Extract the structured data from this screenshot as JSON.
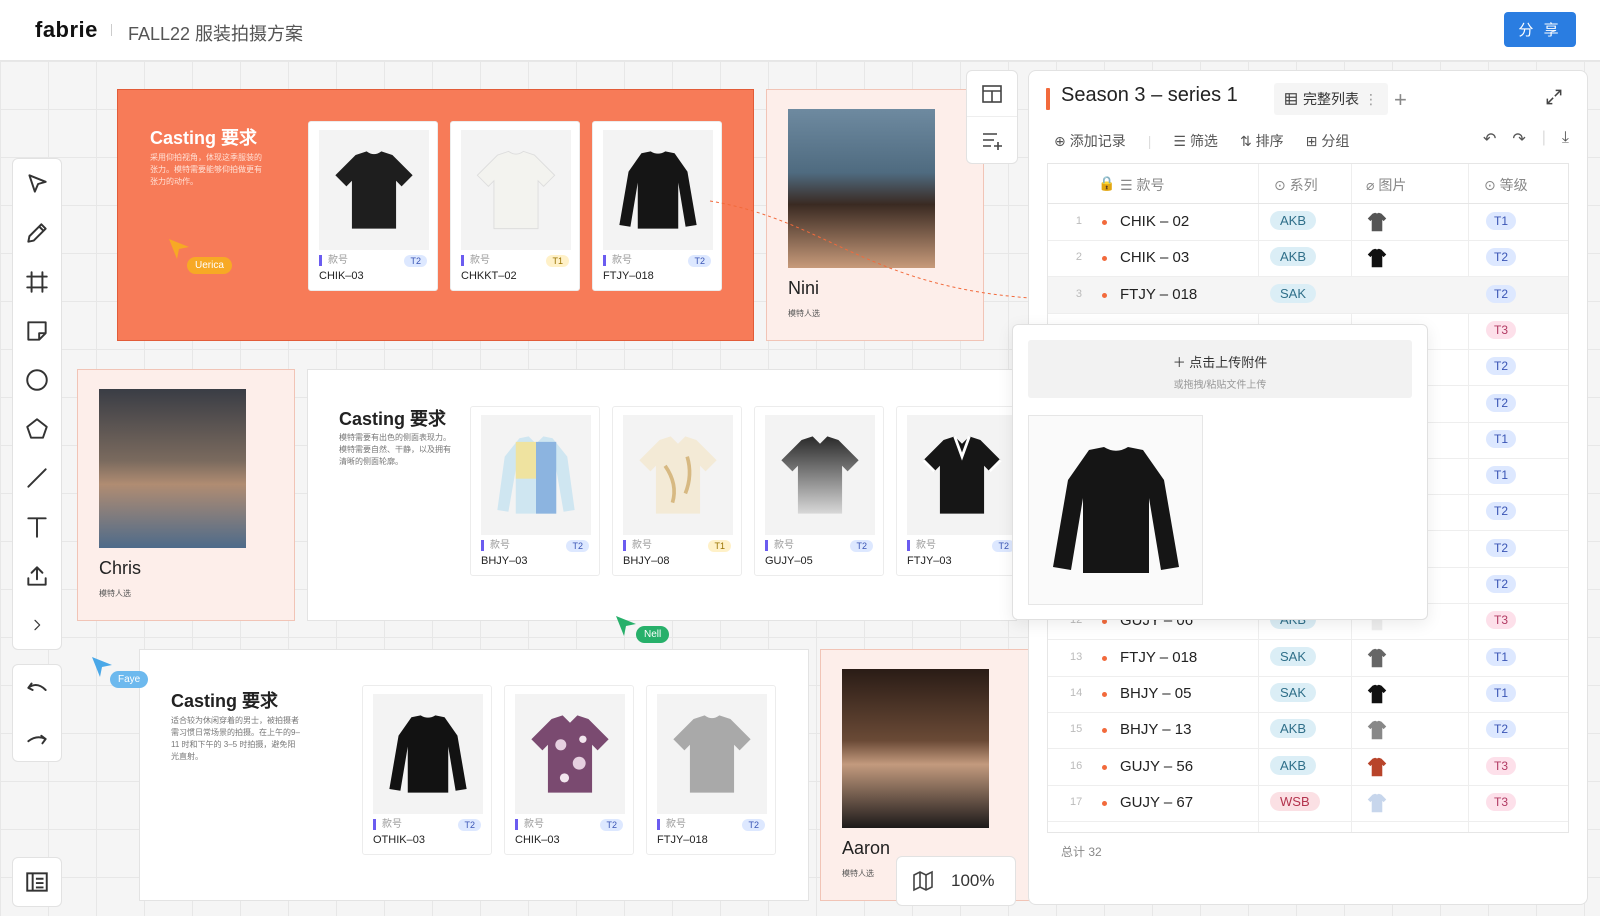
{
  "app": {
    "logo": "fabrie",
    "doc_title": "FALL22 服装拍摄方案",
    "share_label": "分 享"
  },
  "boards": [
    {
      "title": "Casting 要求",
      "desc": "采用仰拍视角，体现这季服装的张力。模特需要能够仰拍做更有张力的动作。",
      "cards": [
        {
          "label": "款号",
          "code": "CHIK–03",
          "grade": "T2"
        },
        {
          "label": "款号",
          "code": "CHKKT–02",
          "grade": "T1"
        },
        {
          "label": "款号",
          "code": "FTJY–018",
          "grade": "T2"
        }
      ]
    },
    {
      "title": "Casting 要求",
      "desc": "模特需要有出色的侧面表现力。模特需要自然、干静，以及拥有清晰的侧面轮廓。",
      "cards": [
        {
          "label": "款号",
          "code": "BHJY–03",
          "grade": "T2"
        },
        {
          "label": "款号",
          "code": "BHJY–08",
          "grade": "T1"
        },
        {
          "label": "款号",
          "code": "GUJY–05",
          "grade": "T2"
        },
        {
          "label": "款号",
          "code": "FTJY–03",
          "grade": "T2"
        }
      ]
    },
    {
      "title": "Casting 要求",
      "desc": "适合较为休闲穿着的男士，被拍摄者需习惯日常场景的拍摄。在上午的9–11 时和下午的 3–5 时拍摄，避免阳光直射。",
      "cards": [
        {
          "label": "款号",
          "code": "OTHIK–03",
          "grade": "T2"
        },
        {
          "label": "款号",
          "code": "CHIK–03",
          "grade": "T2"
        },
        {
          "label": "款号",
          "code": "FTJY–018",
          "grade": "T2"
        }
      ]
    }
  ],
  "models": [
    {
      "name": "Nini",
      "sub": "模特人选"
    },
    {
      "name": "Chris",
      "sub": "模特人选"
    },
    {
      "name": "Aaron",
      "sub": "模特人选"
    }
  ],
  "cursors": [
    {
      "name": "Uerica"
    },
    {
      "name": "Nell"
    },
    {
      "name": "Faye"
    }
  ],
  "panel": {
    "title": "Season 3  – series 1",
    "view": "完整列表",
    "actions": [
      "添加记录",
      "筛选",
      "排序",
      "分组"
    ],
    "columns": [
      "款号",
      "系列",
      "图片",
      "等级"
    ],
    "rows": [
      {
        "n": "1",
        "code": "CHIK – 02",
        "series": "AKB",
        "grade": "T1"
      },
      {
        "n": "2",
        "code": "CHIK – 03",
        "series": "AKB",
        "grade": "T2"
      },
      {
        "n": "3",
        "code": "FTJY – 018",
        "series": "SAK",
        "grade": "T2"
      },
      {
        "n": "",
        "code": "",
        "series": "",
        "grade": "T3"
      },
      {
        "n": "",
        "code": "",
        "series": "",
        "grade": "T2"
      },
      {
        "n": "",
        "code": "",
        "series": "",
        "grade": "T2"
      },
      {
        "n": "",
        "code": "",
        "series": "",
        "grade": "T1"
      },
      {
        "n": "",
        "code": "",
        "series": "",
        "grade": "T1"
      },
      {
        "n": "",
        "code": "",
        "series": "",
        "grade": "T2"
      },
      {
        "n": "",
        "code": "",
        "series": "",
        "grade": "T2"
      },
      {
        "n": "",
        "code": "",
        "series": "",
        "grade": "T2"
      },
      {
        "n": "12",
        "code": "GUJY – 06",
        "series": "AKB",
        "grade": "T3"
      },
      {
        "n": "13",
        "code": "FTJY – 018",
        "series": "SAK",
        "grade": "T1"
      },
      {
        "n": "14",
        "code": "BHJY – 05",
        "series": "SAK",
        "grade": "T1"
      },
      {
        "n": "15",
        "code": "BHJY – 13",
        "series": "AKB",
        "grade": "T2"
      },
      {
        "n": "16",
        "code": "GUJY – 56",
        "series": "AKB",
        "grade": "T3"
      },
      {
        "n": "17",
        "code": "GUJY – 67",
        "series": "WSB",
        "grade": "T3"
      }
    ],
    "total": "总计 32"
  },
  "popup": {
    "upload_label": "＋ 点击上传附件",
    "upload_hint": "或拖拽/粘贴文件上传"
  },
  "zoom": "100%"
}
